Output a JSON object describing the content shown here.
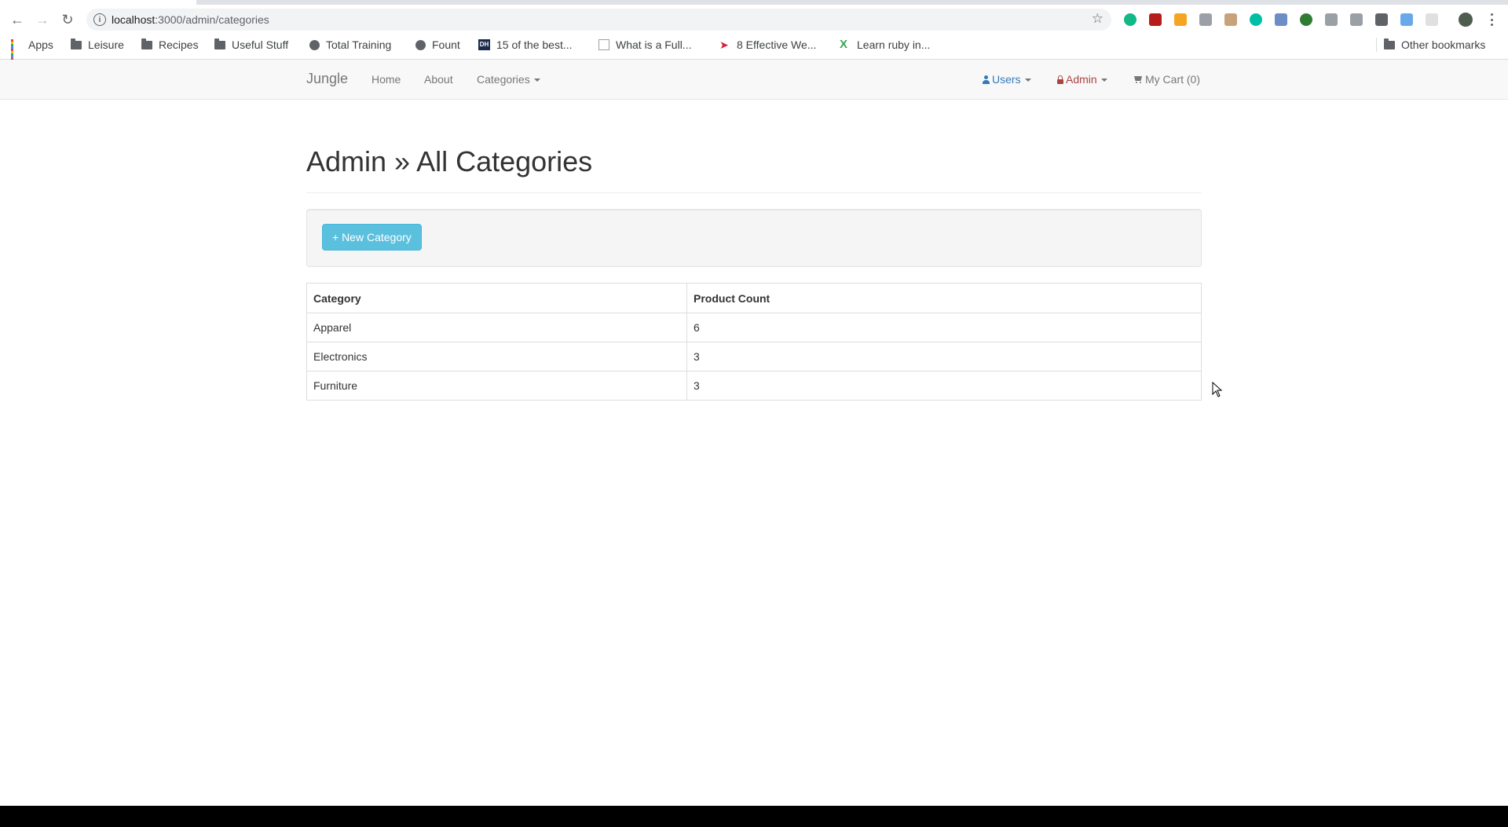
{
  "browser": {
    "url_host": "localhost",
    "url_path": ":3000/admin/categories",
    "extension_colors": [
      "#12b886",
      "#b71c1c",
      "#f4a623",
      "#9aa0a6",
      "#c8a27a",
      "#00bfa5",
      "#6b8ec7",
      "#2e7d32",
      "#9aa0a6",
      "#9aa0a6",
      "#5f6368",
      "#6aa9e9",
      "#e0e0e0"
    ],
    "bookmarks": [
      {
        "label": "Apps",
        "icon": "apps-icon"
      },
      {
        "label": "Leisure",
        "icon": "folder-icon"
      },
      {
        "label": "Recipes",
        "icon": "folder-icon"
      },
      {
        "label": "Useful Stuff",
        "icon": "folder-icon"
      },
      {
        "label": "Total Training",
        "icon": "globe-icon"
      },
      {
        "label": "Fount",
        "icon": "globe-icon"
      },
      {
        "label": "15 of the best...",
        "icon": "dh-icon"
      },
      {
        "label": "What is a Full...",
        "icon": "page-icon"
      },
      {
        "label": "8 Effective We...",
        "icon": "pin-icon"
      },
      {
        "label": "Learn ruby in...",
        "icon": "x-icon"
      }
    ],
    "other_bookmarks": "Other bookmarks"
  },
  "navbar": {
    "brand": "Jungle",
    "home": "Home",
    "about": "About",
    "categories": "Categories",
    "users": "Users",
    "admin": "Admin",
    "cart": "My Cart (0)",
    "colors": {
      "users": "#337ab7",
      "admin": "#a94442"
    }
  },
  "page": {
    "title": "Admin » All Categories",
    "new_button": "+ New Category"
  },
  "table": {
    "headers": [
      "Category",
      "Product Count"
    ],
    "rows": [
      [
        "Apparel",
        "6"
      ],
      [
        "Electronics",
        "3"
      ],
      [
        "Furniture",
        "3"
      ]
    ]
  }
}
